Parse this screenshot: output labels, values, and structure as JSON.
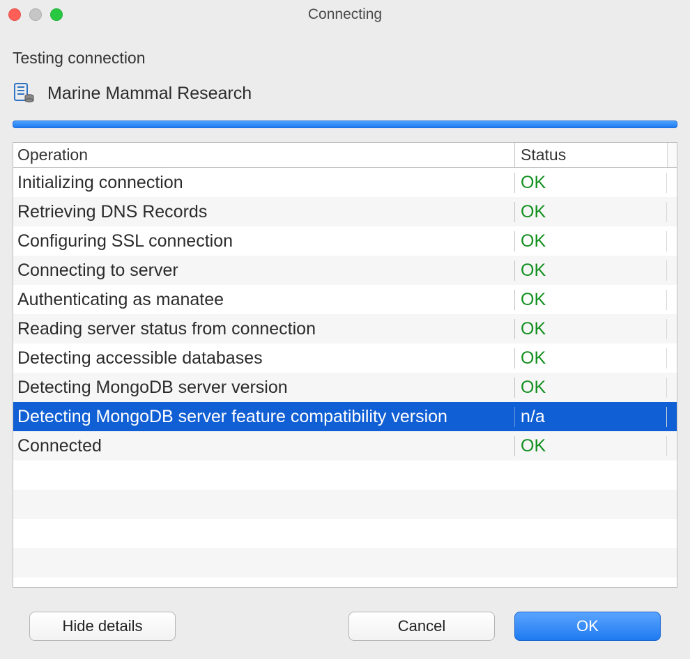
{
  "window": {
    "title": "Connecting"
  },
  "header": {
    "heading": "Testing connection",
    "connection_name": "Marine Mammal Research"
  },
  "table": {
    "columns": {
      "operation": "Operation",
      "status": "Status"
    },
    "rows": [
      {
        "operation": "Initializing connection",
        "status": "OK",
        "status_kind": "ok",
        "selected": false
      },
      {
        "operation": "Retrieving DNS Records",
        "status": "OK",
        "status_kind": "ok",
        "selected": false
      },
      {
        "operation": "Configuring SSL connection",
        "status": "OK",
        "status_kind": "ok",
        "selected": false
      },
      {
        "operation": "Connecting to server",
        "status": "OK",
        "status_kind": "ok",
        "selected": false
      },
      {
        "operation": "Authenticating as manatee",
        "status": "OK",
        "status_kind": "ok",
        "selected": false
      },
      {
        "operation": "Reading server status from connection",
        "status": "OK",
        "status_kind": "ok",
        "selected": false
      },
      {
        "operation": "Detecting accessible databases",
        "status": "OK",
        "status_kind": "ok",
        "selected": false
      },
      {
        "operation": "Detecting MongoDB server version",
        "status": "OK",
        "status_kind": "ok",
        "selected": false
      },
      {
        "operation": "Detecting MongoDB server feature compatibility version",
        "status": "n/a",
        "status_kind": "na",
        "selected": true
      },
      {
        "operation": "Connected",
        "status": "OK",
        "status_kind": "ok",
        "selected": false
      }
    ]
  },
  "buttons": {
    "hide_details": "Hide details",
    "cancel": "Cancel",
    "ok": "OK"
  }
}
